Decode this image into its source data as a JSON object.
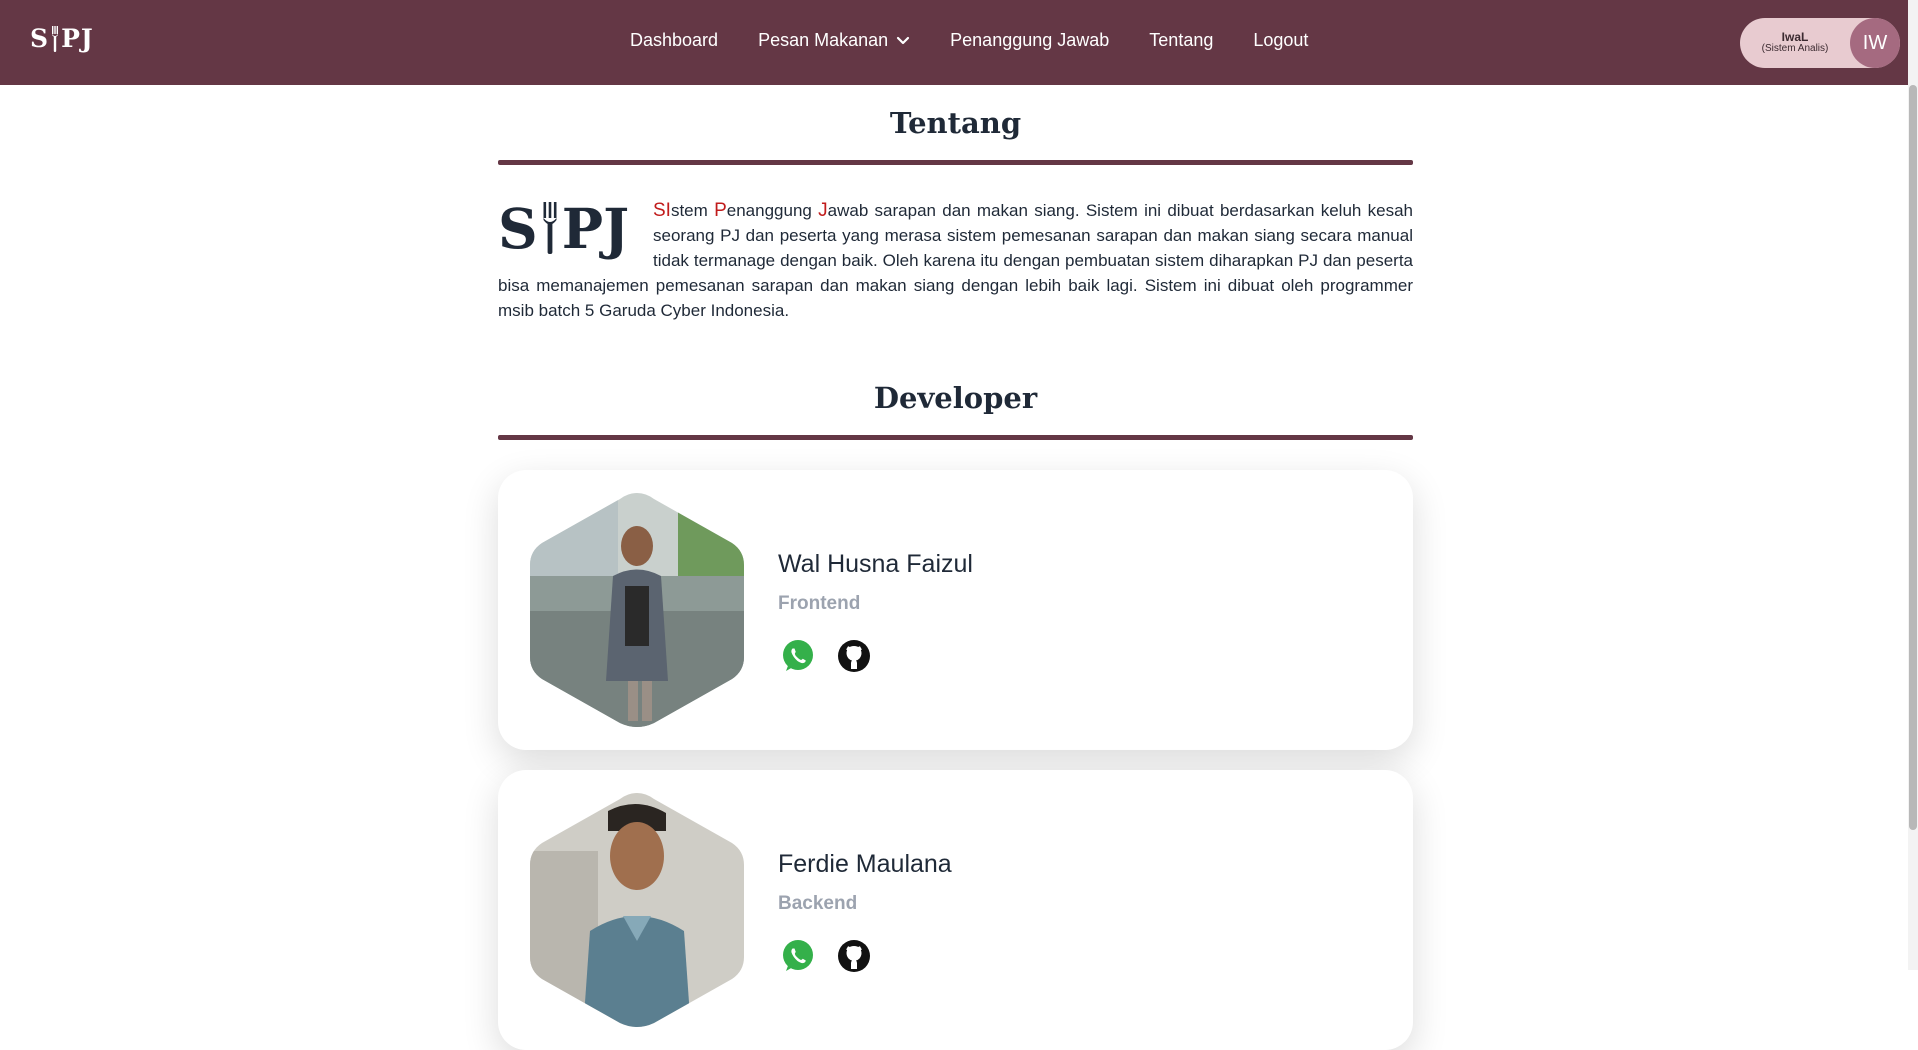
{
  "brand": {
    "left": "S",
    "right": "PJ",
    "icon": "fork-icon"
  },
  "nav": {
    "items": [
      {
        "label": "Dashboard"
      },
      {
        "label": "Pesan Makanan",
        "dropdown": true
      },
      {
        "label": "Penanggung Jawab"
      },
      {
        "label": "Tentang"
      },
      {
        "label": "Logout"
      }
    ]
  },
  "user": {
    "name": "IwaL",
    "role": "(Sistem Analis)",
    "initials": "IW"
  },
  "about": {
    "title": "Tentang",
    "accent_1": "SI",
    "text_1": "stem ",
    "accent_2": "P",
    "text_2": "enanggung ",
    "accent_3": "J",
    "text_3": "awab sarapan dan makan siang. Sistem ini dibuat berdasarkan keluh kesah seorang PJ dan peserta yang merasa sistem pemesanan sarapan dan makan siang secara manual tidak termanage dengan baik. Oleh karena itu dengan pembuatan sistem diharapkan PJ dan peserta bisa memanajemen pemesanan sarapan dan makan siang dengan lebih baik lagi. Sistem ini dibuat oleh programmer msib batch 5 Garuda Cyber Indonesia."
  },
  "developer": {
    "title": "Developer",
    "cards": [
      {
        "name": "Wal Husna Faizul",
        "role": "Frontend",
        "icons": [
          "whatsapp-icon",
          "github-icon"
        ]
      },
      {
        "name": "Ferdie Maulana",
        "role": "Backend",
        "icons": [
          "whatsapp-icon",
          "github-icon"
        ]
      }
    ]
  },
  "colors": {
    "primary": "#643745",
    "accent": "#c11c1c",
    "pill": "#e8cbd0",
    "avatar": "#a56a80"
  }
}
